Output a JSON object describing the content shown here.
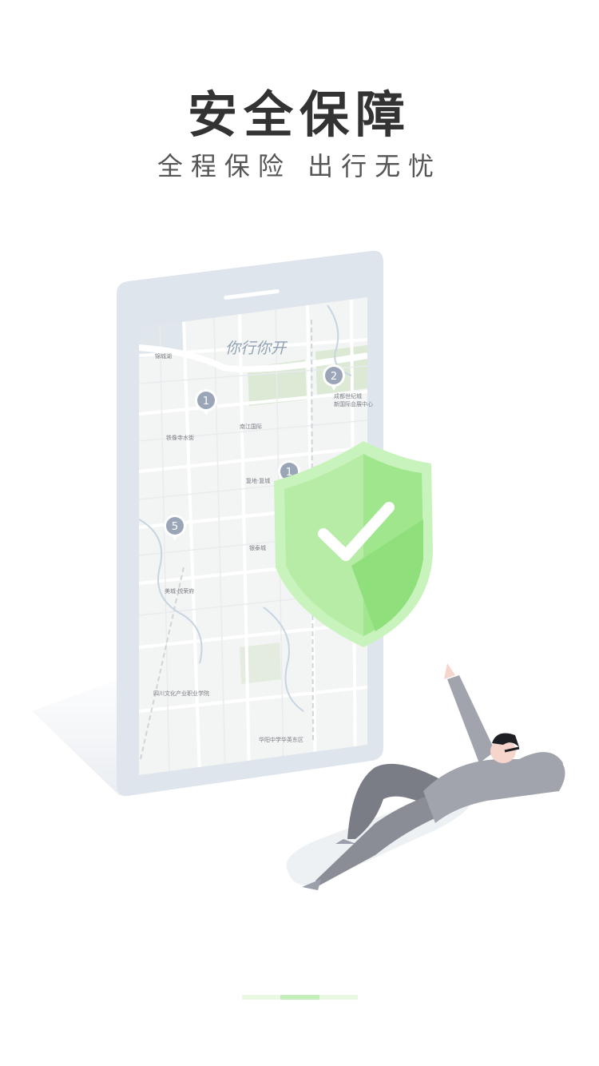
{
  "header": {
    "title": "安全保障",
    "subtitle": "全程保险 出行无忧"
  },
  "map": {
    "banner": "你行你开",
    "labels": [
      "锦城湖",
      "铁像寺水街",
      "南江国际",
      "复地·复城",
      "银泰城",
      "美城·悦荣府",
      "成都世纪城",
      "新国际会展中心",
      "四川文化产业职业学院",
      "华阳中学华英东区"
    ],
    "pins": [
      "1",
      "2",
      "1",
      "5"
    ]
  },
  "pager": {
    "count": 3,
    "active_index": 1
  },
  "colors": {
    "shield": "#8fe07d",
    "shield_light": "#c9f3bc",
    "indicator_active": "#c4efba",
    "indicator_inactive": "#e8f8e3",
    "phone_frame": "#dfe5ec"
  },
  "icons": [
    "shield-check-icon",
    "map-pin-icon"
  ]
}
